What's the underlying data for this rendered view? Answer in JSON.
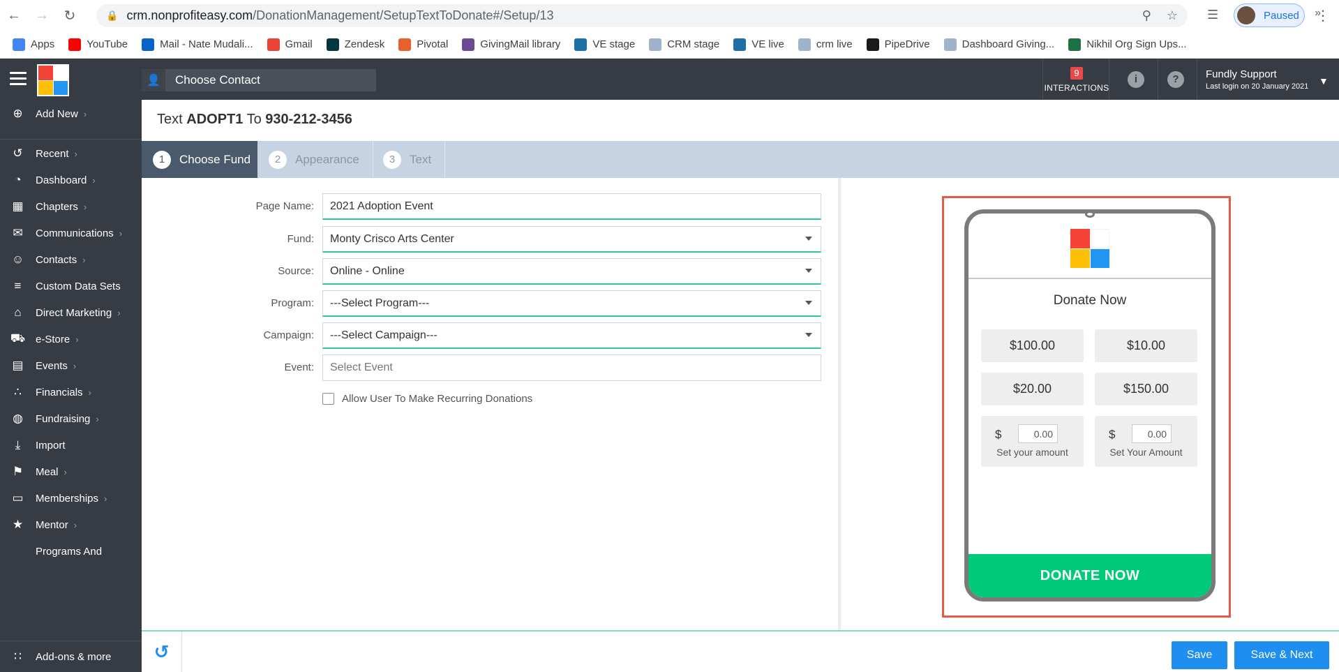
{
  "browser": {
    "url_host": "crm.nonprofiteasy.com",
    "url_path": "/DonationManagement/SetupTextToDonate#/Setup/13",
    "profile_label": "Paused",
    "bookmarks": [
      {
        "label": "Apps",
        "icon": "apps-grid-icon",
        "color": "#4285f4"
      },
      {
        "label": "YouTube",
        "icon": "youtube-icon",
        "color": "#ff0000"
      },
      {
        "label": "Mail - Nate Mudali...",
        "icon": "outlook-icon",
        "color": "#0a64c8"
      },
      {
        "label": "Gmail",
        "icon": "google-icon",
        "color": "#ea4335"
      },
      {
        "label": "Zendesk",
        "icon": "zendesk-icon",
        "color": "#03363d"
      },
      {
        "label": "Pivotal",
        "icon": "pivotal-icon",
        "color": "#e8612c"
      },
      {
        "label": "GivingMail library",
        "icon": "givingmail-icon",
        "color": "#6a4c93"
      },
      {
        "label": "VE stage",
        "icon": "ve-icon",
        "color": "#1d6fa5"
      },
      {
        "label": "CRM stage",
        "icon": "crm-icon",
        "color": "#9fb4cc"
      },
      {
        "label": "VE live",
        "icon": "ve-icon",
        "color": "#1d6fa5"
      },
      {
        "label": "crm live",
        "icon": "crm-icon",
        "color": "#9fb4cc"
      },
      {
        "label": "PipeDrive",
        "icon": "pipedrive-icon",
        "color": "#1a1a1a"
      },
      {
        "label": "Dashboard Giving...",
        "icon": "dashboard-icon",
        "color": "#9fb4cc"
      },
      {
        "label": "Nikhil Org Sign Ups...",
        "icon": "excel-icon",
        "color": "#1d7044"
      }
    ]
  },
  "header": {
    "choose_contact": "Choose Contact",
    "interactions_count": "9",
    "interactions_label": "INTERACTIONS",
    "user_name": "Fundly Support",
    "last_login": "Last login on 20 January 2021"
  },
  "sidebar": {
    "items": [
      {
        "label": "Add New",
        "icon": "plus-circle-icon",
        "chev": true
      },
      {
        "label": "Recent",
        "icon": "history-icon",
        "chev": true
      },
      {
        "label": "Dashboard",
        "icon": "dashboard-gauge-icon",
        "chev": true
      },
      {
        "label": "Chapters",
        "icon": "grid-icon",
        "chev": true
      },
      {
        "label": "Communications",
        "icon": "envelope-icon",
        "chev": true
      },
      {
        "label": "Contacts",
        "icon": "person-icon",
        "chev": true
      },
      {
        "label": "Custom Data Sets",
        "icon": "layers-icon",
        "chev": false
      },
      {
        "label": "Direct Marketing",
        "icon": "bank-icon",
        "chev": true
      },
      {
        "label": "e-Store",
        "icon": "cart-icon",
        "chev": true
      },
      {
        "label": "Events",
        "icon": "calendar-icon",
        "chev": true
      },
      {
        "label": "Financials",
        "icon": "money-icon",
        "chev": true
      },
      {
        "label": "Fundraising",
        "icon": "moneybag-icon",
        "chev": true
      },
      {
        "label": "Import",
        "icon": "download-icon",
        "chev": false
      },
      {
        "label": "Meal",
        "icon": "utensils-icon",
        "chev": true
      },
      {
        "label": "Memberships",
        "icon": "id-card-icon",
        "chev": true
      },
      {
        "label": "Mentor",
        "icon": "mentor-icon",
        "chev": true
      },
      {
        "label": "Programs And",
        "icon": "",
        "chev": false
      }
    ],
    "addons": "Add-ons & more"
  },
  "page": {
    "title_prefix": "Text",
    "keyword": "ADOPT1",
    "title_mid": "To",
    "phone_number": "930-212-3456"
  },
  "steps": [
    {
      "num": "1",
      "label": "Choose Fund"
    },
    {
      "num": "2",
      "label": "Appearance"
    },
    {
      "num": "3",
      "label": "Text"
    }
  ],
  "form": {
    "page_name_label": "Page Name:",
    "page_name_value": "2021 Adoption Event",
    "fund_label": "Fund:",
    "fund_value": "Monty Crisco Arts Center",
    "source_label": "Source:",
    "source_value": "Online - Online",
    "program_label": "Program:",
    "program_value": "---Select Program---",
    "campaign_label": "Campaign:",
    "campaign_value": "---Select Campaign---",
    "event_label": "Event:",
    "event_placeholder": "Select Event",
    "recurring_label": "Allow User To Make Recurring Donations"
  },
  "preview": {
    "title": "Donate Now",
    "amounts": [
      "$100.00",
      "$10.00",
      "$20.00",
      "$150.00"
    ],
    "currency_symbol": "$",
    "custom_value_1": "0.00",
    "custom_label_1": "Set your amount",
    "custom_value_2": "0.00",
    "custom_label_2": "Set Your Amount",
    "donate_button": "DONATE NOW"
  },
  "footer": {
    "save": "Save",
    "save_next": "Save & Next"
  },
  "colors": {
    "header_bg": "#373c44",
    "accent_green": "#2ec4a0",
    "donate_green": "#00c979",
    "primary_blue": "#1f8ef1",
    "highlight_red": "#e35a47",
    "logo_red": "#f44336",
    "logo_yellow": "#ffc107",
    "logo_blue": "#2196f3"
  }
}
